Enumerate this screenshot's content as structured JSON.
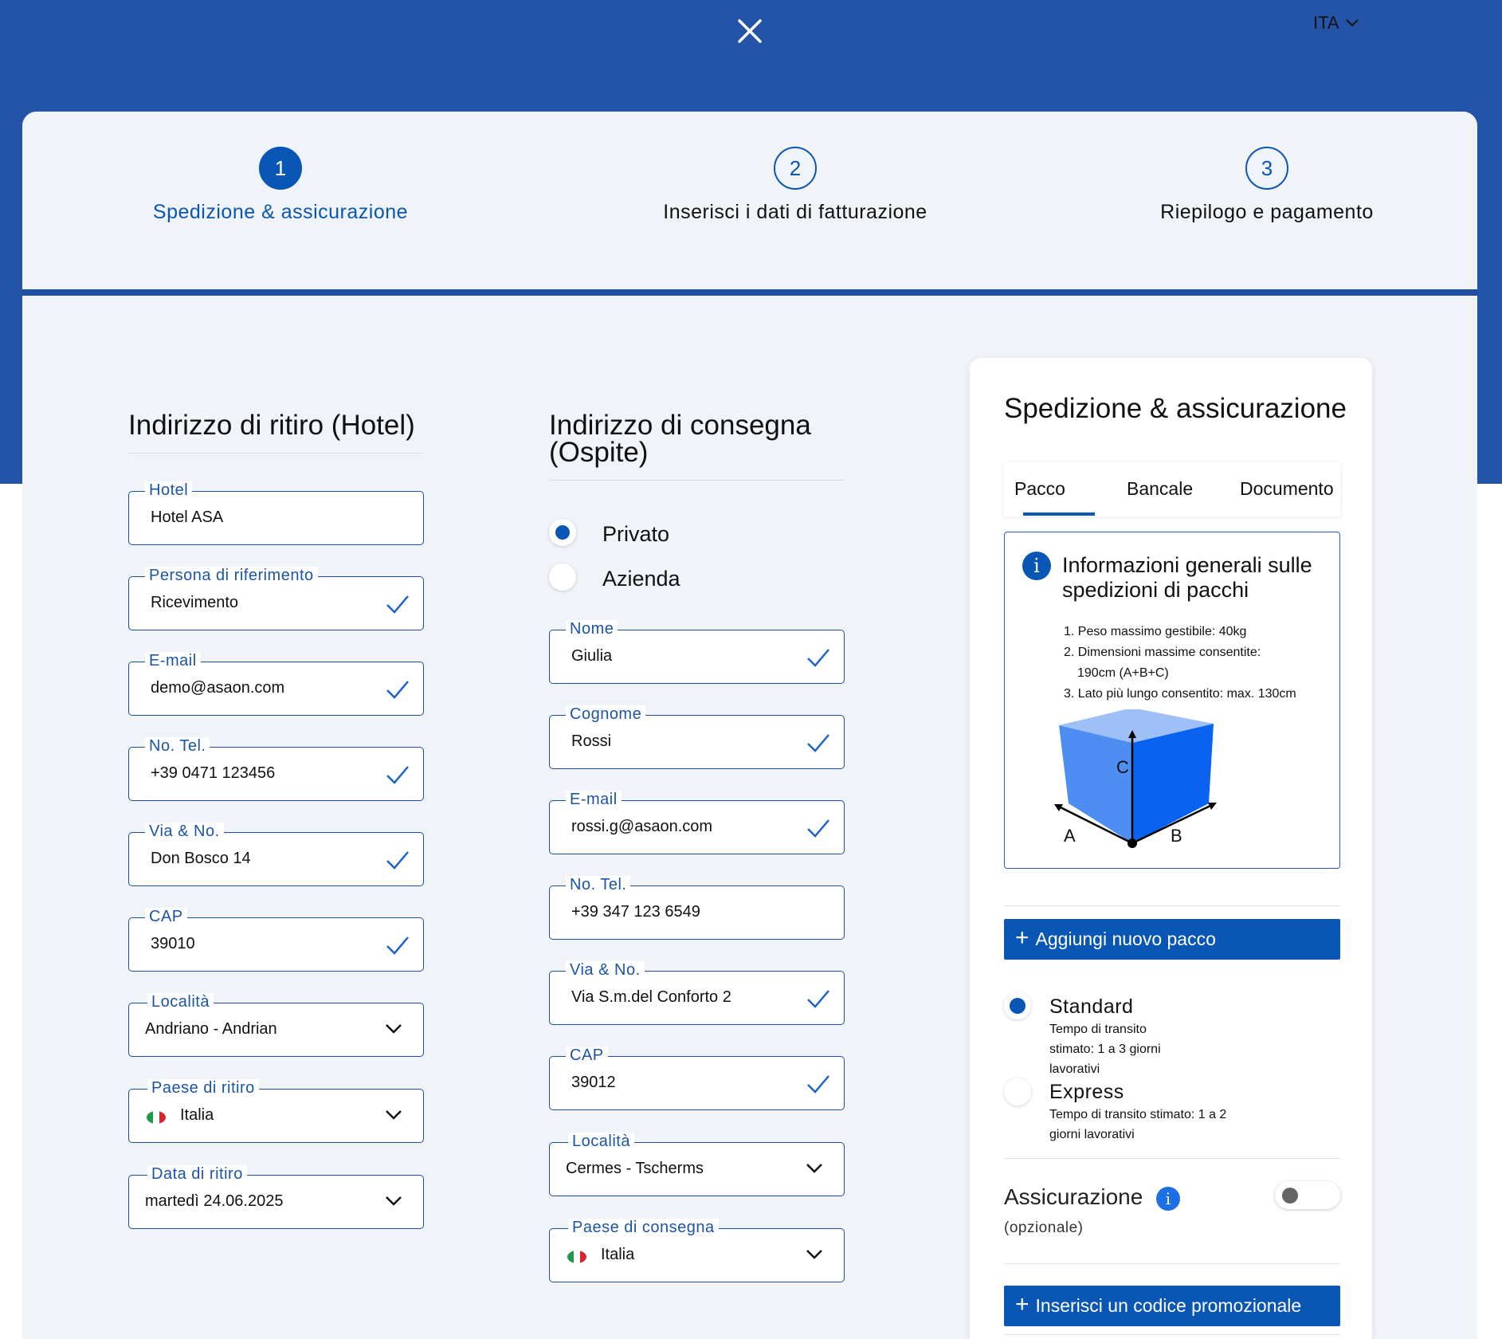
{
  "header": {
    "close_icon": "close-icon",
    "language": "ITA"
  },
  "steps": [
    {
      "number": "1",
      "label": "Spedizione & assicurazione",
      "active": true
    },
    {
      "number": "2",
      "label": "Inserisci i dati di fatturazione",
      "active": false
    },
    {
      "number": "3",
      "label": "Riepilogo e pagamento",
      "active": false
    }
  ],
  "pickup": {
    "title": "Indirizzo di ritiro (Hotel)",
    "fields": {
      "hotel": {
        "label": "Hotel",
        "value": "Hotel ASA"
      },
      "contact": {
        "label": "Persona di riferimento",
        "value": "Ricevimento"
      },
      "email": {
        "label": "E-mail",
        "value": "demo@asaon.com"
      },
      "phone": {
        "label": "No. Tel.",
        "value": "+39 0471 123456"
      },
      "street": {
        "label": "Via & No.",
        "value": "Don Bosco 14"
      },
      "zip": {
        "label": "CAP",
        "value": "39010"
      },
      "city": {
        "label": "Località",
        "value": "Andriano - Andrian"
      },
      "country": {
        "label": "Paese di ritiro",
        "value": "Italia"
      },
      "date": {
        "label": "Data di ritiro",
        "value": "martedì 24.06.2025"
      }
    }
  },
  "delivery": {
    "title_line1": "Indirizzo di consegna",
    "title_line2": "(Ospite)",
    "type_options": [
      {
        "label": "Privato",
        "selected": true
      },
      {
        "label": "Azienda",
        "selected": false
      }
    ],
    "fields": {
      "first_name": {
        "label": "Nome",
        "value": "Giulia"
      },
      "last_name": {
        "label": "Cognome",
        "value": "Rossi"
      },
      "email": {
        "label": "E-mail",
        "value": "rossi.g@asaon.com"
      },
      "phone": {
        "label": "No. Tel.",
        "value": "+39 347 123 6549"
      },
      "street": {
        "label": "Via & No.",
        "value": "Via S.m.del Conforto 2"
      },
      "zip": {
        "label": "CAP",
        "value": "39012"
      },
      "city": {
        "label": "Località",
        "value": "Cermes - Tscherms"
      },
      "country": {
        "label": "Paese di consegna",
        "value": "Italia"
      }
    }
  },
  "shipping_panel": {
    "title": "Spedizione & assicurazione",
    "tabs": [
      "Pacco",
      "Bancale",
      "Documento"
    ],
    "active_tab": "Pacco",
    "info": {
      "title": "Informazioni generali sulle spedizioni di pacchi",
      "items": [
        "1. Peso massimo gestibile: 40kg",
        "2. Dimensioni massime consentite:",
        "190cm (A+B+C)",
        "3. Lato più lungo consentito: max. 130cm"
      ],
      "diagram_labels": {
        "a": "A",
        "b": "B",
        "c": "C"
      }
    },
    "add_package_label": "Aggiungi nuovo pacco",
    "shipping_options": [
      {
        "name": "Standard",
        "desc_lines": [
          "Tempo di transito",
          "stimato: 1 a 3 giorni",
          "lavorativi"
        ],
        "selected": true
      },
      {
        "name": "Express",
        "desc_lines": [
          "Tempo di transito stimato: 1 a 2",
          "giorni lavorativi"
        ],
        "selected": false
      }
    ],
    "insurance": {
      "title": "Assicurazione",
      "subtitle": "(opzionale)",
      "enabled": false
    },
    "promo_label": "Inserisci un codice promozionale"
  },
  "colors": {
    "brand_blue": "#2454a8",
    "accent": "#0a56b4",
    "card_bg": "#f0f3f8"
  }
}
